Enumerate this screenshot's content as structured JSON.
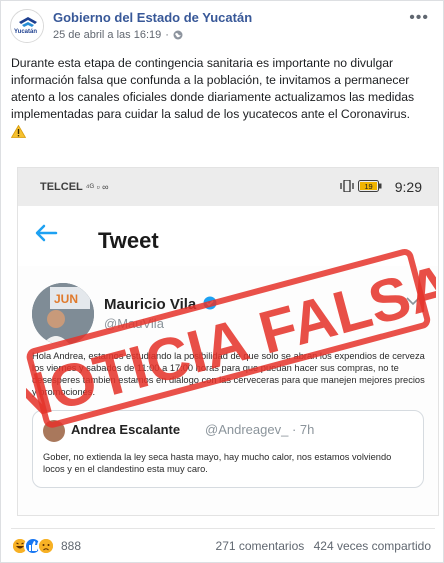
{
  "post": {
    "page_name": "Gobierno del Estado de Yucatán",
    "avatar_text": "Yucatán",
    "timestamp": "25 de abril a las 16:19",
    "audience_icon": "globe-icon",
    "caption": "Durante esta etapa de contingencia sanitaria es importante no divulgar información falsa que confunda a la población, te invitamos a permanecer atento a los canales oficiales donde diariamente actualizamos las medidas implementadas para cuidar la salud de los yucatecos ante el Coronavirus.",
    "caption_icon": "warning-icon"
  },
  "screenshot": {
    "carrier": "TELCEL",
    "carrier_extra": "⁴ᴳ ▫ ∞",
    "battery": "19",
    "clock": "9:29",
    "screen_title": "Tweet",
    "author": {
      "name": "Mauricio Vila",
      "handle": "@MauVila",
      "avatar_label": "JUN"
    },
    "tweet_text": "Hola Andrea, estamos estudiando la posibilidad de que solo se abran los expendios de cerveza  los viernes y sabados de 11:00 a 17:00 horas para que puedan hacer sus compras, no te desesperes tambien estamos en dialogo con las cerveceras para que manejen mejores precios y promociones.",
    "quote": {
      "name": "Andrea Escalante",
      "handle": "@Andreagev_",
      "time": "· 7h",
      "text": "Gober, no extienda la ley seca hasta mayo, hay mucho calor, nos estamos volviendo locos y en el clandestino esta muy caro."
    },
    "stamp": "NOTICIA FALSA"
  },
  "footer": {
    "reactions_count": "888",
    "comments": "271 comentarios",
    "shares": "424 veces compartido"
  },
  "colors": {
    "link_blue": "#385898",
    "stamp_red": "#e5332a",
    "fb_like_blue": "#1877f2",
    "haha_yellow": "#f7b125"
  }
}
